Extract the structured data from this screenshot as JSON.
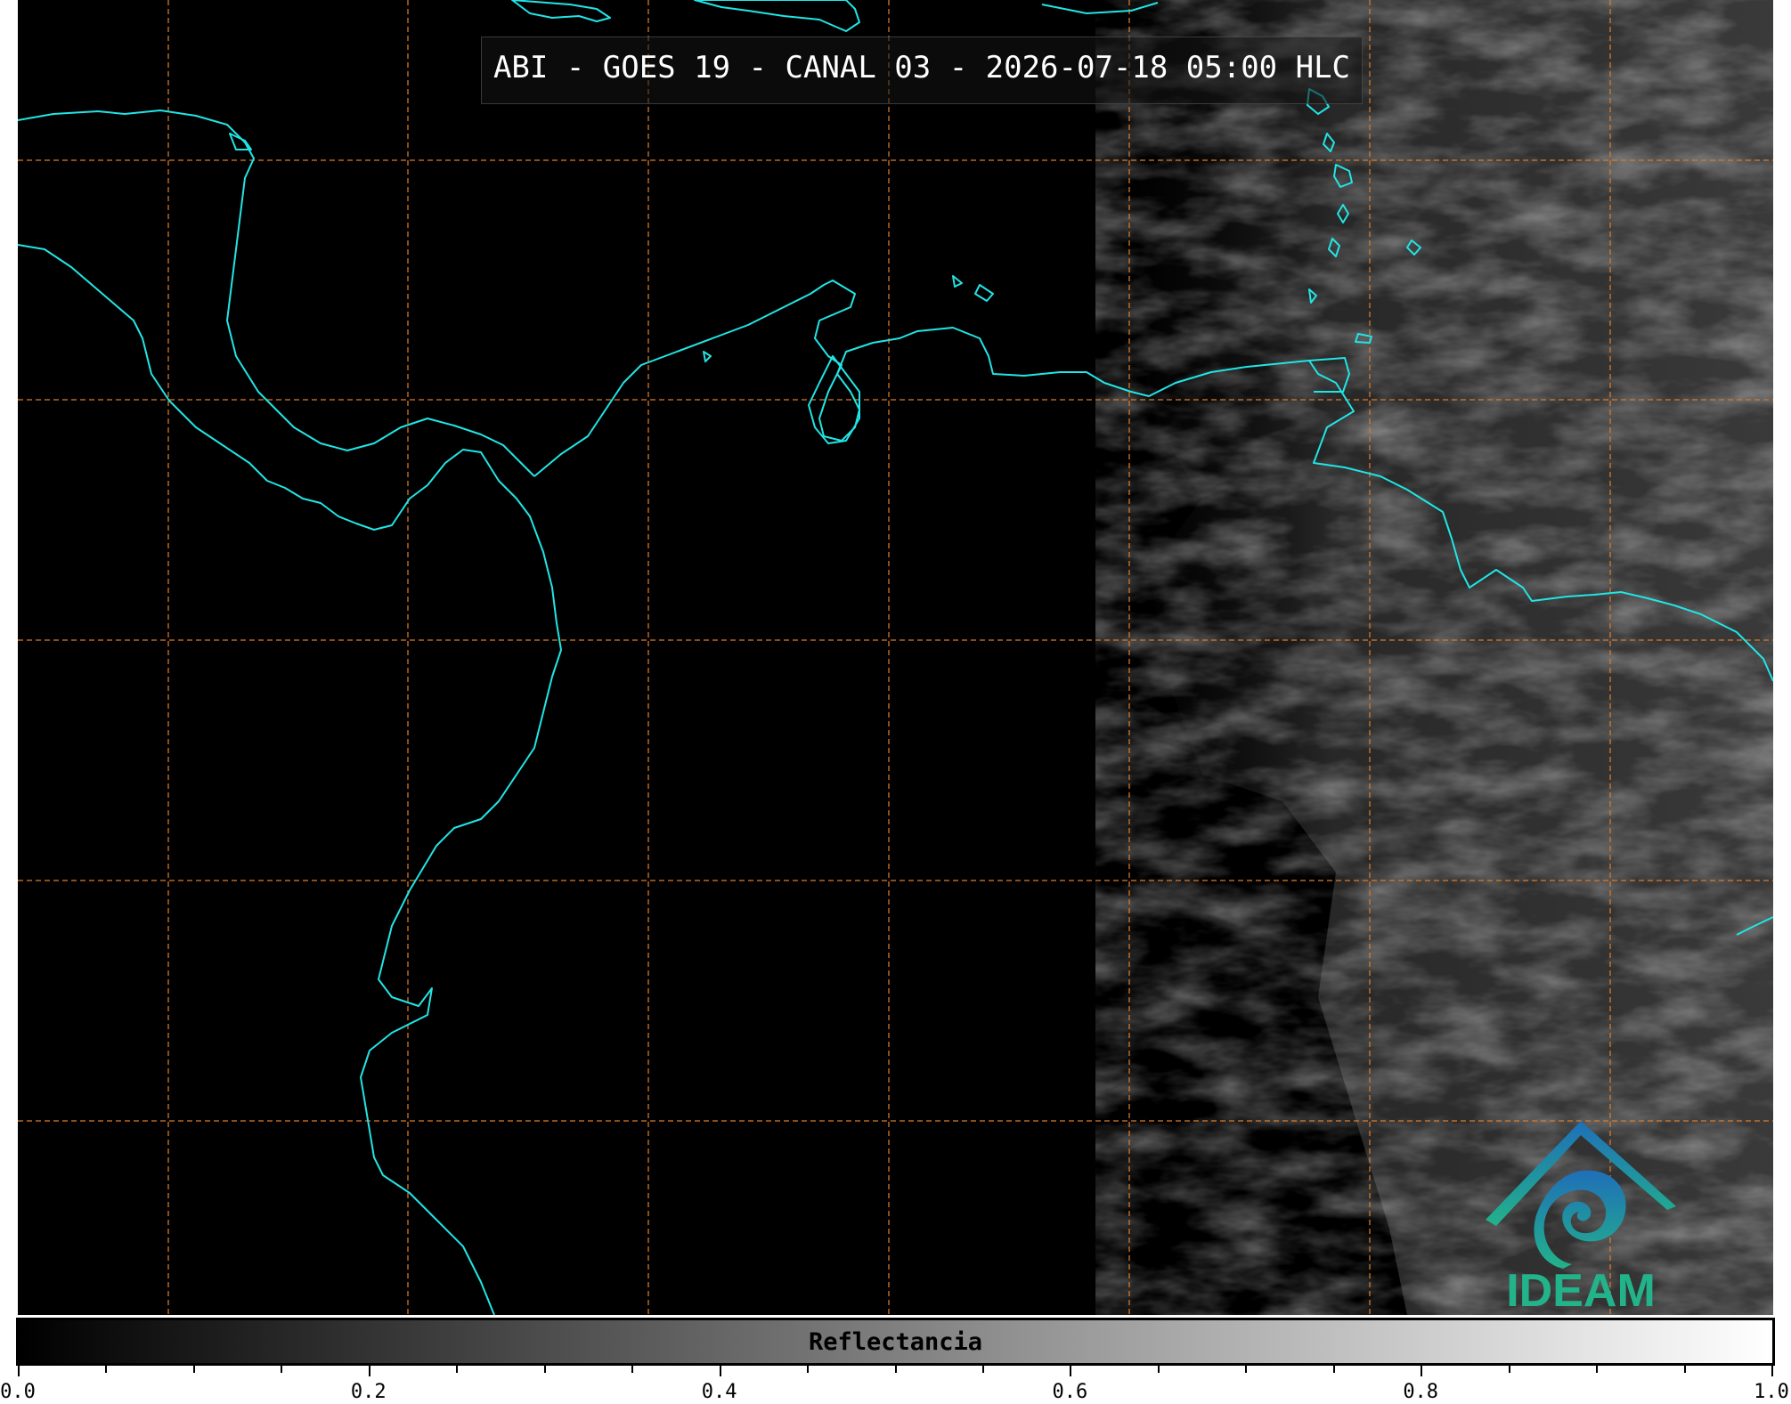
{
  "title": "ABI - GOES 19 - CANAL 03 - 2026-07-18 05:00 HLC",
  "colorbar": {
    "label": "Reflectancia",
    "range": [
      0.0,
      1.0
    ],
    "tick_labels": [
      "0.0",
      "0.2",
      "0.4",
      "0.6",
      "0.8",
      "1.0"
    ],
    "tick_values": [
      0.0,
      0.2,
      0.4,
      0.6,
      0.8,
      1.0
    ],
    "minor_step": 0.05,
    "colormap": [
      "#000000",
      "#ffffff"
    ]
  },
  "map": {
    "background": "#000000",
    "coastline_color": "#22e5e5",
    "gridline_color": "#d97a2a",
    "gridline_style": "dashed",
    "illuminated_side": "east",
    "cloud_tone": "#6a6a6a"
  },
  "logo": {
    "text": "IDEAM",
    "colors": [
      "#1f78b4",
      "#22b38a"
    ]
  }
}
